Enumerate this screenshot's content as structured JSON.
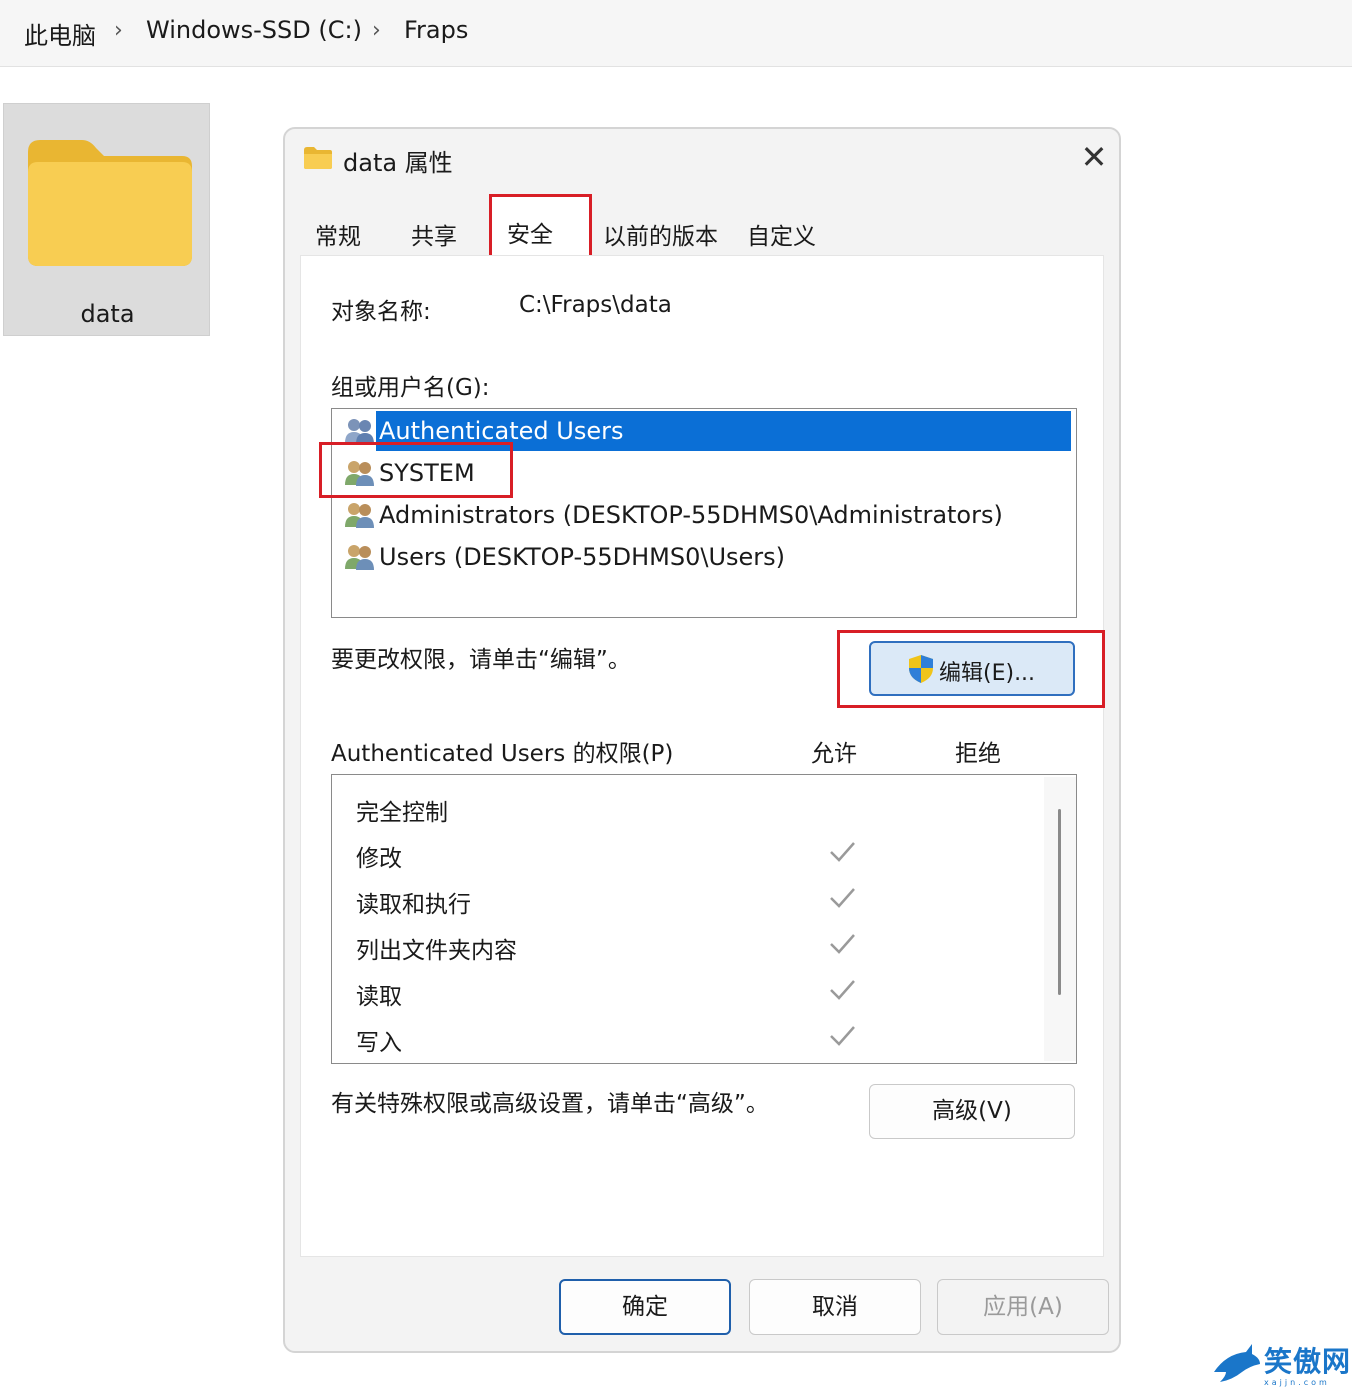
{
  "breadcrumb": {
    "items": [
      "此电脑",
      "Windows-SSD (C:)",
      "Fraps"
    ],
    "separator": "›"
  },
  "folder": {
    "label": "data",
    "icon": "folder-icon"
  },
  "dialog": {
    "title": "data 属性",
    "close_icon": "close-icon",
    "tabs": [
      {
        "label": "常规"
      },
      {
        "label": "共享"
      },
      {
        "label": "安全",
        "active": true
      },
      {
        "label": "以前的版本"
      },
      {
        "label": "自定义"
      }
    ],
    "object_name_label": "对象名称:",
    "object_name_value": "C:\\Fraps\\data",
    "group_label": "组或用户名(G):",
    "users": [
      {
        "label": "Authenticated Users",
        "selected": true
      },
      {
        "label": "SYSTEM"
      },
      {
        "label": "Administrators (DESKTOP-55DHMS0\\Administrators)"
      },
      {
        "label": "Users (DESKTOP-55DHMS0\\Users)"
      }
    ],
    "change_hint": "要更改权限，请单击“编辑”。",
    "edit_button": "编辑(E)...",
    "perm_header": "Authenticated Users 的权限(P)",
    "allow_header": "允许",
    "deny_header": "拒绝",
    "permissions": [
      {
        "name": "完全控制",
        "allow": false
      },
      {
        "name": "修改",
        "allow": true
      },
      {
        "name": "读取和执行",
        "allow": true
      },
      {
        "name": "列出文件夹内容",
        "allow": true
      },
      {
        "name": "读取",
        "allow": true
      },
      {
        "name": "写入",
        "allow": true
      }
    ],
    "advanced_hint": "有关特殊权限或高级设置，请单击“高级”。",
    "advanced_button": "高级(V)",
    "ok_button": "确定",
    "cancel_button": "取消",
    "apply_button": "应用(A)"
  },
  "colors": {
    "selection": "#0b6fd6",
    "highlight_box": "#d81e26",
    "folder": "#f8c84a",
    "check": "#9a9a9a"
  },
  "watermark": {
    "text": "笑傲网",
    "sub": "xajjn.com"
  }
}
